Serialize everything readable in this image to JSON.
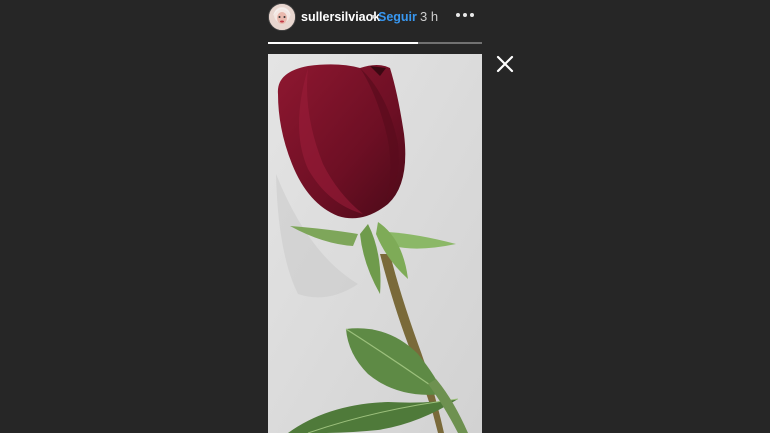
{
  "header": {
    "username": "sullersilviaok",
    "separator": "•",
    "follow_label": "Seguir",
    "time_ago": "3 h"
  },
  "icons": {
    "avatar": "profile-avatar",
    "more": "more-options-icon",
    "close": "close-icon"
  },
  "story": {
    "progress_fraction": 0.7,
    "image": "red-rose-photo"
  },
  "colors": {
    "background": "#262626",
    "follow": "#3897f0",
    "text": "#ffffff"
  }
}
